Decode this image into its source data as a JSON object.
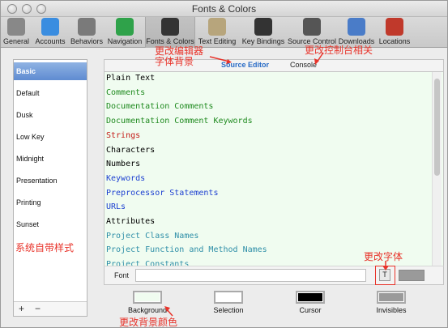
{
  "window": {
    "title": "Fonts & Colors"
  },
  "toolbar": {
    "items": [
      {
        "label": "General",
        "icon": "general-switch-icon",
        "color": "#888888"
      },
      {
        "label": "Accounts",
        "icon": "at-sign-icon",
        "color": "#3a8de0"
      },
      {
        "label": "Behaviors",
        "icon": "gears-icon",
        "color": "#7a7a7a"
      },
      {
        "label": "Navigation",
        "icon": "navigation-arrows-icon",
        "color": "#2fa24a"
      },
      {
        "label": "Fonts & Colors",
        "icon": "fonts-colors-icon",
        "color": "#333333",
        "selected": true
      },
      {
        "label": "Text Editing",
        "icon": "text-editing-icon",
        "color": "#b7a57c"
      },
      {
        "label": "Key Bindings",
        "icon": "keyboard-icon",
        "color": "#333333"
      },
      {
        "label": "Source Control",
        "icon": "source-control-icon",
        "color": "#555555"
      },
      {
        "label": "Downloads",
        "icon": "download-arrow-icon",
        "color": "#4a7cc8"
      },
      {
        "label": "Locations",
        "icon": "joystick-icon",
        "color": "#c0392b"
      }
    ]
  },
  "themes": {
    "items": [
      "Basic",
      "Default",
      "Dusk",
      "Low Key",
      "Midnight",
      "Presentation",
      "Printing",
      "Sunset"
    ],
    "selected": "Basic",
    "add_label": "+",
    "remove_label": "−"
  },
  "tabs": {
    "source_editor": "Source Editor",
    "console": "Console"
  },
  "syntax_rows": [
    {
      "label": "Plain Text",
      "color": "#000000"
    },
    {
      "label": "Comments",
      "color": "#1f8a1f"
    },
    {
      "label": "Documentation Comments",
      "color": "#1f8a1f"
    },
    {
      "label": "Documentation Comment Keywords",
      "color": "#1f8a1f"
    },
    {
      "label": "Strings",
      "color": "#c41a16"
    },
    {
      "label": "Characters",
      "color": "#000000"
    },
    {
      "label": "Numbers",
      "color": "#000000"
    },
    {
      "label": "Keywords",
      "color": "#1c3fd1"
    },
    {
      "label": "Preprocessor Statements",
      "color": "#1c3fd1"
    },
    {
      "label": "URLs",
      "color": "#1c3fd1"
    },
    {
      "label": "Attributes",
      "color": "#000000"
    },
    {
      "label": "Project Class Names",
      "color": "#2f8fa8"
    },
    {
      "label": "Project Function and Method Names",
      "color": "#2f8fa8"
    },
    {
      "label": "Project Constants",
      "color": "#2f8fa8"
    }
  ],
  "font_row": {
    "label": "Font",
    "value": "",
    "button_glyph": "T"
  },
  "color_wells": [
    {
      "label": "Background",
      "color": "#f0fcf0"
    },
    {
      "label": "Selection",
      "color": "#ffffff"
    },
    {
      "label": "Cursor",
      "color": "#000000"
    },
    {
      "label": "Invisibles",
      "color": "#9a9a9a"
    }
  ],
  "annotations": {
    "editor_bg": "更改编辑器\n字体背景",
    "console": "更改控制台相关",
    "theme_styles": "系统自带样式",
    "change_font": "更改字体",
    "background_color": "更改背景颜色"
  }
}
